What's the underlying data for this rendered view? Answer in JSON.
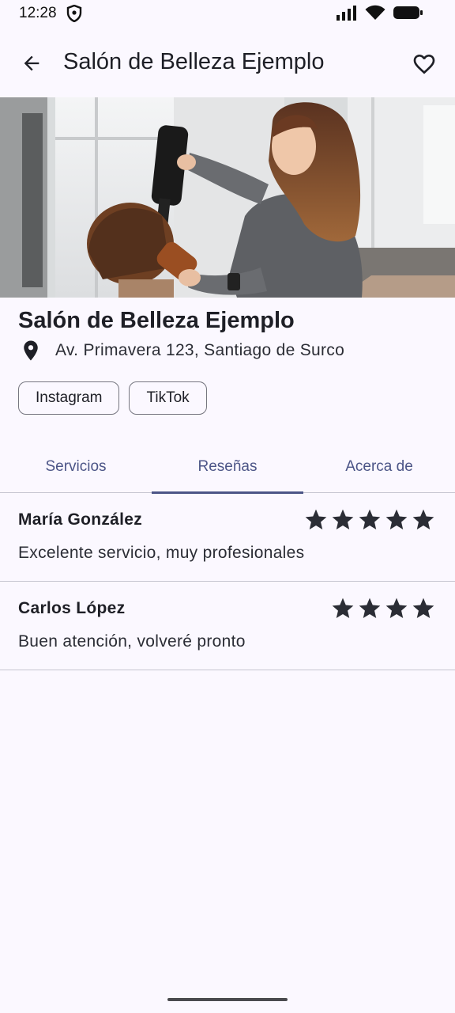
{
  "status_bar": {
    "time": "12:28"
  },
  "app_bar": {
    "title": "Salón de Belleza Ejemplo",
    "back_icon": "arrow-back-icon",
    "favorite_icon": "heart-outline-icon"
  },
  "salon": {
    "name": "Salón de Belleza Ejemplo",
    "address": "Av. Primavera 123, Santiago de Surco",
    "location_icon": "location-pin-icon",
    "social": [
      "Instagram",
      "TikTok"
    ]
  },
  "tabs": {
    "items": [
      "Servicios",
      "Reseñas",
      "Acerca de"
    ],
    "selected": "Reseñas"
  },
  "reviews": [
    {
      "author": "María González",
      "rating": 5,
      "text": "Excelente servicio, muy profesionales"
    },
    {
      "author": "Carlos López",
      "rating": 4,
      "text": "Buen atención, volveré pronto"
    }
  ],
  "colors": {
    "background": "#FBF8FF",
    "accent": "#4C5587",
    "star": "#2B2D35",
    "divider": "#C6C5D0"
  }
}
